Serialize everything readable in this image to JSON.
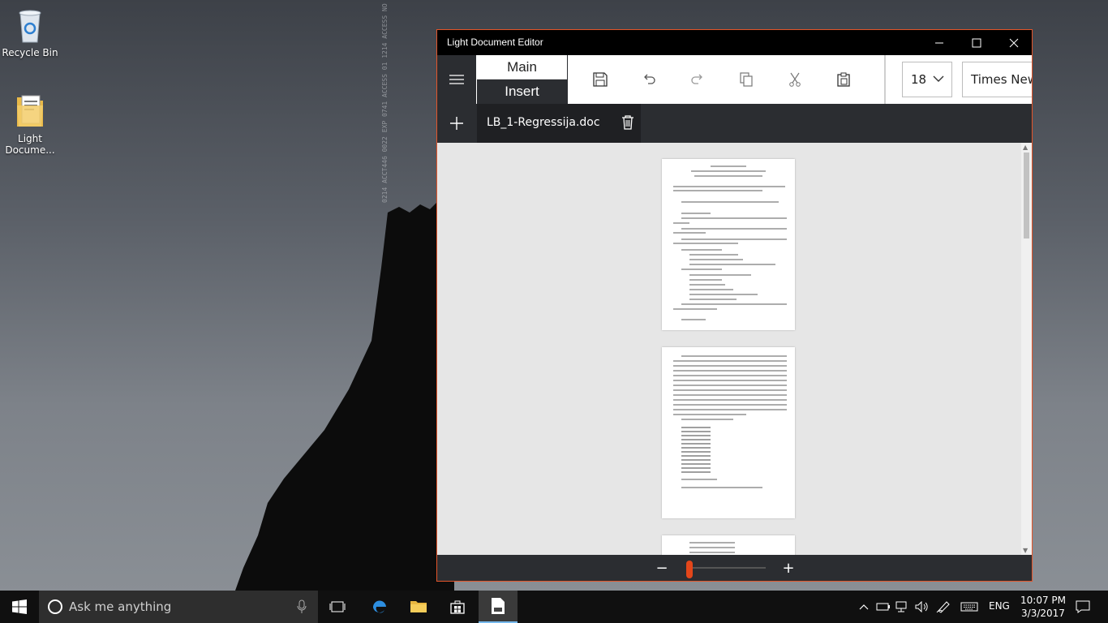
{
  "desktop": {
    "icons": [
      {
        "label": "Recycle Bin",
        "icon": "recycle-bin-icon"
      },
      {
        "label": "Light Docume...",
        "icon": "document-folder-icon"
      }
    ]
  },
  "window": {
    "title": "Light Document Editor",
    "controls": {
      "minimize": "minimize-icon",
      "maximize": "maximize-icon",
      "close": "close-icon"
    }
  },
  "toolbar": {
    "tabs": [
      "Main",
      "Insert"
    ],
    "selected_tab": "Insert",
    "buttons": [
      "save-icon",
      "undo-icon",
      "redo-icon",
      "copy-icon",
      "cut-icon",
      "paste-icon"
    ],
    "font_size": "18",
    "font_name": "Times New"
  },
  "document_tabs": [
    {
      "name": "LB_1-Regressija.doc"
    }
  ],
  "zoom": {
    "minus": "−",
    "plus": "+",
    "level_fraction": 0.0
  },
  "taskbar": {
    "search_placeholder": "Ask me anything",
    "language": "ENG",
    "time": "10:07 PM",
    "date": "3/3/2017"
  },
  "colors": {
    "accent": "#e3552a",
    "zoom_thumb": "#e3461a",
    "window_dark": "#2b2d31",
    "taskbar": "#101010"
  }
}
